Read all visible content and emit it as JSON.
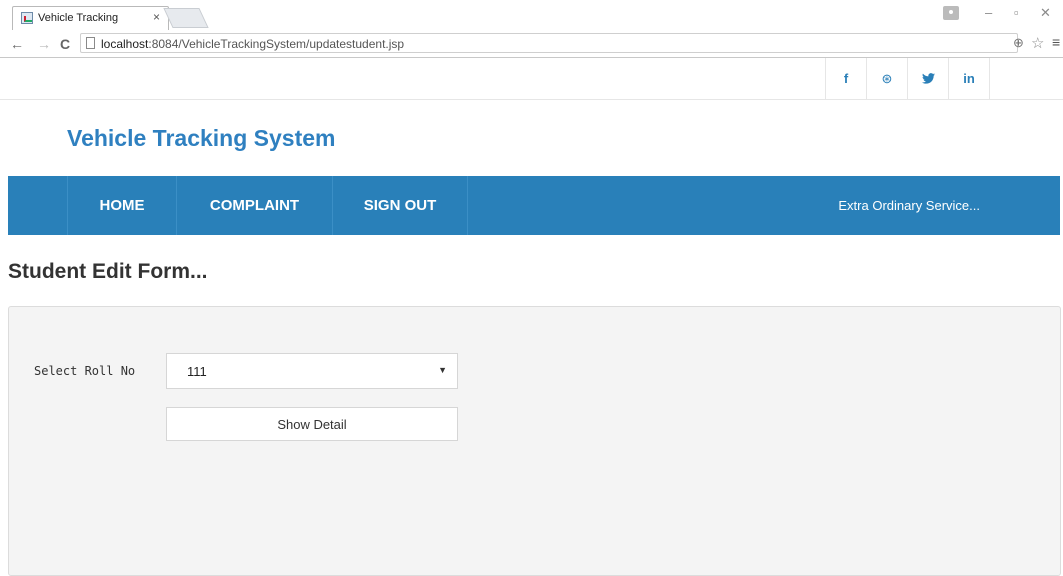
{
  "browser": {
    "tab_title": "Vehicle Tracking",
    "tab_close": "×",
    "url_host": "localhost",
    "url_rest": ":8084/VehicleTrackingSystem/updatestudent.jsp",
    "back": "←",
    "forward": "→",
    "reload": "C",
    "minimize": "–",
    "restore": "▫",
    "close": "✕",
    "zoom": "⊕",
    "star": "☆",
    "menu": "≡"
  },
  "social": {
    "facebook": "f",
    "dribbble": "⊛",
    "twitter": "🐦",
    "linkedin": "in"
  },
  "brand": "Vehicle Tracking System",
  "nav": {
    "items": [
      "HOME",
      "COMPLAINT",
      "SIGN OUT"
    ],
    "tagline": "Extra Ordinary Service..."
  },
  "page": {
    "heading": "Student Edit Form..."
  },
  "form": {
    "roll_label": "Select Roll No",
    "roll_value": "111",
    "dropdown_arrow": "▼",
    "show_button": "Show Detail"
  }
}
